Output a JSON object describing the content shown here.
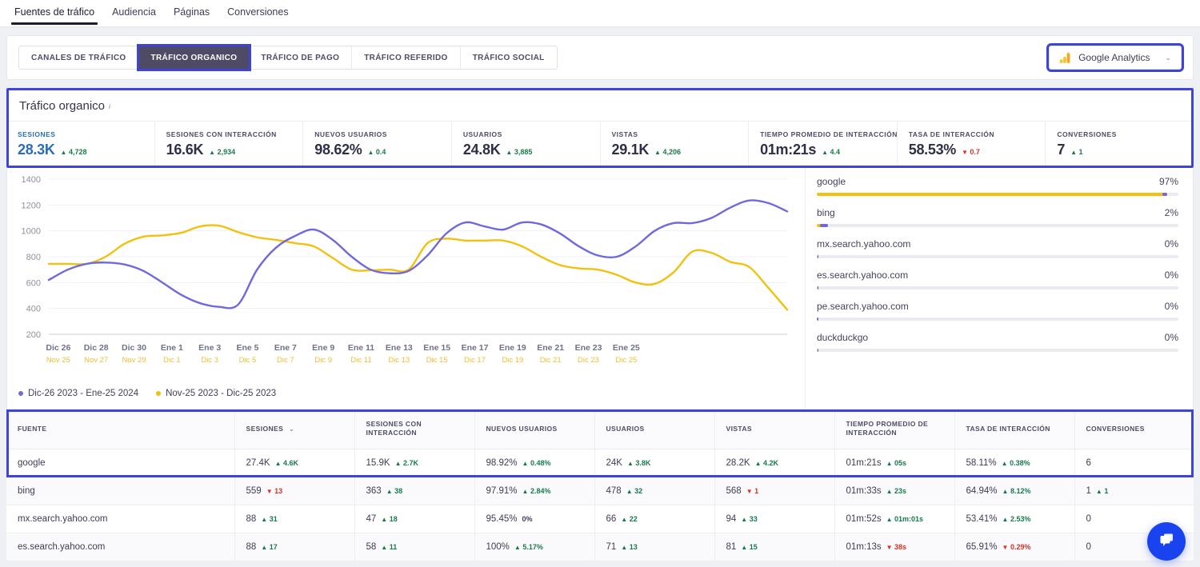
{
  "topnav": {
    "items": [
      {
        "label": "Fuentes de tráfico",
        "active": true
      },
      {
        "label": "Audiencia",
        "active": false
      },
      {
        "label": "Páginas",
        "active": false
      },
      {
        "label": "Conversiones",
        "active": false
      }
    ]
  },
  "subtabs": {
    "items": [
      {
        "label": "CANALES DE TRÁFICO",
        "active": false
      },
      {
        "label": "TRÁFICO ORGANICO",
        "active": true
      },
      {
        "label": "TRÁFICO DE PAGO",
        "active": false
      },
      {
        "label": "TRÁFICO REFERIDO",
        "active": false
      },
      {
        "label": "TRÁFICO SOCIAL",
        "active": false
      }
    ]
  },
  "source_selector": {
    "label": "Google Analytics",
    "icon": "google-analytics-icon",
    "chevron": "⌄"
  },
  "kpi": {
    "title": "Tráfico organico",
    "info_glyph": "i",
    "cards": [
      {
        "label": "SESIONES",
        "value": "28.3K",
        "delta": "4,728",
        "dir": "up",
        "primary": true
      },
      {
        "label": "SESIONES CON INTERACCIÓN",
        "value": "16.6K",
        "delta": "2,934",
        "dir": "up",
        "primary": false
      },
      {
        "label": "NUEVOS USUARIOS",
        "value": "98.62%",
        "delta": "0.4",
        "dir": "up",
        "primary": false
      },
      {
        "label": "USUARIOS",
        "value": "24.8K",
        "delta": "3,885",
        "dir": "up",
        "primary": false
      },
      {
        "label": "VISTAS",
        "value": "29.1K",
        "delta": "4,206",
        "dir": "up",
        "primary": false
      },
      {
        "label": "TIEMPO PROMEDIO DE INTERACCIÓN",
        "value": "01m:21s",
        "delta": "4.4",
        "dir": "up",
        "primary": false
      },
      {
        "label": "TASA DE INTERACCIÓN",
        "value": "58.53%",
        "delta": "0.7",
        "dir": "down",
        "primary": false
      },
      {
        "label": "CONVERSIONES",
        "value": "7",
        "delta": "1",
        "dir": "up",
        "primary": false
      }
    ]
  },
  "chart_data": {
    "type": "line",
    "title": "",
    "xlabel": "",
    "ylabel": "",
    "ylim": [
      200,
      1400
    ],
    "yticks": [
      1400,
      1200,
      1000,
      800,
      600,
      400,
      200
    ],
    "grid": true,
    "legend_position": "bottom-left",
    "xtick_primary": [
      "Dic 26",
      "Dic 28",
      "Dic 30",
      "Ene 1",
      "Ene 3",
      "Ene 5",
      "Ene 7",
      "Ene 9",
      "Ene 11",
      "Ene 13",
      "Ene 15",
      "Ene 17",
      "Ene 19",
      "Ene 21",
      "Ene 23",
      "Ene 25"
    ],
    "xtick_secondary": [
      "Nov 25",
      "Nov 27",
      "Nov 29",
      "Dic 1",
      "Dic 3",
      "Dic 5",
      "Dic 7",
      "Dic 9",
      "Dic 11",
      "Dic 13",
      "Dic 15",
      "Dic 17",
      "Dic 19",
      "Dic 21",
      "Dic 23",
      "Dic 25"
    ],
    "series": [
      {
        "name": "Dic-26 2023 - Ene-25 2024",
        "color": "#6f69dd",
        "values": [
          620,
          700,
          745,
          755,
          740,
          690,
          600,
          505,
          440,
          412,
          430,
          700,
          870,
          960,
          1010,
          930,
          800,
          700,
          672,
          690,
          810,
          980,
          1065,
          1035,
          1010,
          1065,
          1050,
          980,
          880,
          810,
          800,
          880,
          1000,
          1060,
          1060,
          1100,
          1180,
          1235,
          1215,
          1150
        ]
      },
      {
        "name": "Nov-25 2023 - Dic-25 2023",
        "color": "#f2c110",
        "values": [
          745,
          745,
          745,
          800,
          900,
          955,
          965,
          985,
          1035,
          1040,
          990,
          950,
          930,
          905,
          880,
          790,
          700,
          695,
          700,
          700,
          905,
          940,
          925,
          925,
          925,
          880,
          800,
          735,
          710,
          700,
          660,
          600,
          590,
          680,
          840,
          830,
          760,
          720,
          560,
          390
        ]
      }
    ]
  },
  "sources": {
    "items": [
      {
        "name": "google",
        "pct": "97%",
        "bar_yellow": 97,
        "bar_purple_w": 1.5
      },
      {
        "name": "bing",
        "pct": "2%",
        "bar_yellow": 3.2,
        "bar_purple_w": 2.3
      },
      {
        "name": "mx.search.yahoo.com",
        "pct": "0%",
        "bar_yellow": 0.5,
        "bar_purple_w": 0.35
      },
      {
        "name": "es.search.yahoo.com",
        "pct": "0%",
        "bar_yellow": 0.5,
        "bar_purple_w": 0.2
      },
      {
        "name": "pe.search.yahoo.com",
        "pct": "0%",
        "bar_yellow": 0.4,
        "bar_purple_w": 0.3
      },
      {
        "name": "duckduckgo",
        "pct": "0%",
        "bar_yellow": 0.4,
        "bar_purple_w": 0.25
      }
    ]
  },
  "table": {
    "sort_chevron": "⌄",
    "columns": [
      "FUENTE",
      "SESIONES",
      "SESIONES CON INTERACCIÓN",
      "NUEVOS USUARIOS",
      "USUARIOS",
      "VISTAS",
      "TIEMPO PROMEDIO DE INTERACCIÓN",
      "TASA DE INTERACCIÓN",
      "CONVERSIONES"
    ],
    "rows": [
      {
        "highlighted": true,
        "cells": [
          {
            "value": "google",
            "delta": "",
            "dir": ""
          },
          {
            "value": "27.4K",
            "delta": "4.6K",
            "dir": "up"
          },
          {
            "value": "15.9K",
            "delta": "2.7K",
            "dir": "up"
          },
          {
            "value": "98.92%",
            "delta": "0.48%",
            "dir": "up"
          },
          {
            "value": "24K",
            "delta": "3.8K",
            "dir": "up"
          },
          {
            "value": "28.2K",
            "delta": "4.2K",
            "dir": "up"
          },
          {
            "value": "01m:21s",
            "delta": "05s",
            "dir": "up"
          },
          {
            "value": "58.11%",
            "delta": "0.38%",
            "dir": "up"
          },
          {
            "value": "6",
            "delta": "",
            "dir": ""
          }
        ]
      },
      {
        "highlighted": false,
        "cells": [
          {
            "value": "bing",
            "delta": "",
            "dir": ""
          },
          {
            "value": "559",
            "delta": "13",
            "dir": "down"
          },
          {
            "value": "363",
            "delta": "38",
            "dir": "up"
          },
          {
            "value": "97.91%",
            "delta": "2.84%",
            "dir": "up"
          },
          {
            "value": "478",
            "delta": "32",
            "dir": "up"
          },
          {
            "value": "568",
            "delta": "1",
            "dir": "down"
          },
          {
            "value": "01m:33s",
            "delta": "23s",
            "dir": "up"
          },
          {
            "value": "64.94%",
            "delta": "8.12%",
            "dir": "up"
          },
          {
            "value": "1",
            "delta": "1",
            "dir": "up"
          }
        ]
      },
      {
        "highlighted": false,
        "cells": [
          {
            "value": "mx.search.yahoo.com",
            "delta": "",
            "dir": ""
          },
          {
            "value": "88",
            "delta": "31",
            "dir": "up"
          },
          {
            "value": "47",
            "delta": "18",
            "dir": "up"
          },
          {
            "value": "95.45%",
            "delta": "0%",
            "dir": "none"
          },
          {
            "value": "66",
            "delta": "22",
            "dir": "up"
          },
          {
            "value": "94",
            "delta": "33",
            "dir": "up"
          },
          {
            "value": "01m:52s",
            "delta": "01m:01s",
            "dir": "up"
          },
          {
            "value": "53.41%",
            "delta": "2.53%",
            "dir": "up"
          },
          {
            "value": "0",
            "delta": "",
            "dir": ""
          }
        ]
      },
      {
        "highlighted": false,
        "cells": [
          {
            "value": "es.search.yahoo.com",
            "delta": "",
            "dir": ""
          },
          {
            "value": "88",
            "delta": "17",
            "dir": "up"
          },
          {
            "value": "58",
            "delta": "11",
            "dir": "up"
          },
          {
            "value": "100%",
            "delta": "5.17%",
            "dir": "up"
          },
          {
            "value": "71",
            "delta": "13",
            "dir": "up"
          },
          {
            "value": "81",
            "delta": "15",
            "dir": "up"
          },
          {
            "value": "01m:13s",
            "delta": "38s",
            "dir": "down"
          },
          {
            "value": "65.91%",
            "delta": "0.29%",
            "dir": "down"
          },
          {
            "value": "0",
            "delta": "",
            "dir": ""
          }
        ]
      }
    ]
  },
  "chat": {
    "icon": "chat-bubbles-icon"
  },
  "colors": {
    "accent_blue": "#3f44d8",
    "series_purple": "#6f69dd",
    "series_yellow": "#f2c110",
    "up_green": "#177a4c",
    "down_red": "#d93025",
    "primary_kpi_blue": "#2a6ebb",
    "active_tab_bg": "#4f4a66",
    "chat_blue": "#1a43f0"
  }
}
